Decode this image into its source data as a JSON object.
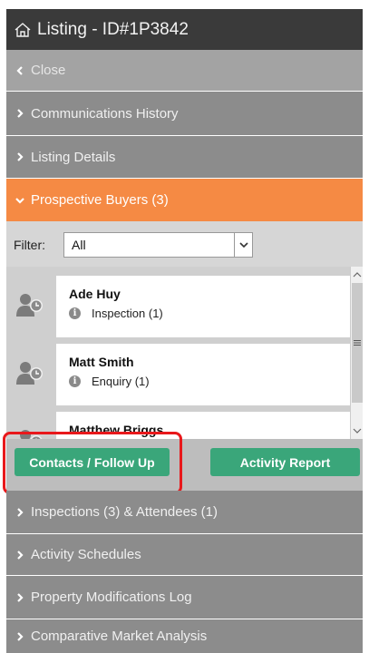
{
  "window": {
    "title": "Listing - ID#1P3842"
  },
  "sections": {
    "close": "Close",
    "communications": "Communications History",
    "details": "Listing Details",
    "buyers": "Prospective Buyers (3)",
    "inspections": "Inspections (3) & Attendees (1)",
    "schedules": "Activity Schedules",
    "modifications": "Property Modifications Log",
    "cma": "Comparative Market Analysis"
  },
  "filter": {
    "label": "Filter:",
    "value": "All"
  },
  "buyers": [
    {
      "name": "Ade Huy",
      "detail": "Inspection (1)"
    },
    {
      "name": "Matt Smith",
      "detail": "Enquiry (1)"
    },
    {
      "name": "Matthew Briggs",
      "detail": ""
    }
  ],
  "buttons": {
    "contacts": "Contacts / Follow Up",
    "activity": "Activity Report"
  },
  "colors": {
    "title_bar": "#3a3a3a",
    "section": "#8c8c8c",
    "active_section": "#f58a44",
    "button": "#3aa67a",
    "highlight": "#e8181b"
  },
  "icons": {
    "title": "home-icon",
    "collapsed": "chevron-right-icon",
    "expanded": "chevron-down-icon",
    "back": "chevron-left-icon",
    "buyer": "person-clock-icon",
    "info": "info-icon"
  }
}
